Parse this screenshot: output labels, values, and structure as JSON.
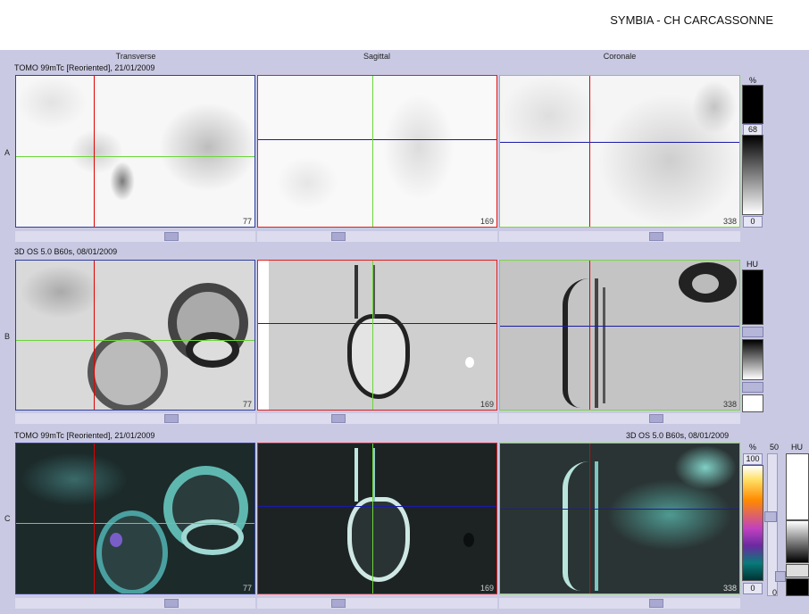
{
  "app": {
    "title": "SYMBIA - CH CARCASSONNE"
  },
  "columns": [
    "Transverse",
    "Sagittal",
    "Coronale"
  ],
  "rows": [
    {
      "label": "A",
      "info": "TOMO 99mTc [Reoriented], 21/01/2009",
      "slices": [
        "77",
        "169",
        "338"
      ]
    },
    {
      "label": "B",
      "info": "3D  OS  5.0  B60s, 08/01/2009",
      "slices": [
        "77",
        "169",
        "338"
      ]
    },
    {
      "label": "C",
      "info": "TOMO 99mTc [Reoriented], 21/01/2009",
      "info_right": "3D  OS  5.0  B60s, 08/01/2009",
      "slices": [
        "77",
        "169",
        "338"
      ]
    }
  ],
  "colorbars": {
    "a": {
      "unit": "%",
      "top_value": "68",
      "bottom_value": "0"
    },
    "b": {
      "unit": "HU"
    },
    "c": {
      "unit": "%",
      "top_value": "100",
      "bottom_value": "0",
      "mid_label": "50",
      "unit2": "HU",
      "bottom_small": "0"
    }
  },
  "colors": {
    "background": "#c9c9e3",
    "red_crosshair": "#e00000",
    "green_crosshair": "#6cd53a",
    "blue_crosshair": "#1a1aa8",
    "transverse_border": "#3040a0",
    "sagittal_border": "#e02020",
    "coronal_border": "#7fd34a"
  },
  "icons": [
    "scroll-thumb",
    "slider-thumb"
  ]
}
